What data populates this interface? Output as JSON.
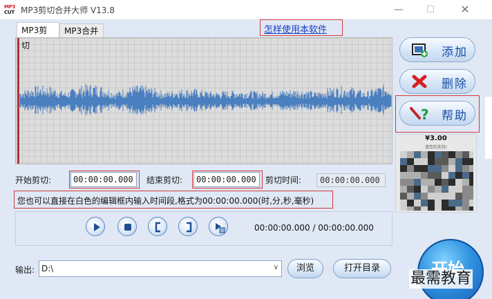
{
  "window": {
    "title": "MP3剪切合并大师 V13.8",
    "icon_top": "MP3",
    "icon_bottom": "CUT"
  },
  "tabs": [
    {
      "label": "MP3剪切",
      "active": true
    },
    {
      "label": "MP3合并",
      "active": false
    }
  ],
  "help_link": "怎样使用本软件",
  "side_buttons": {
    "add": "添加",
    "delete": "删除",
    "help": "帮助"
  },
  "donate": {
    "price": "¥3.00",
    "note": "请您的支持!"
  },
  "time_fields": {
    "start_label": "开始剪切:",
    "start_value": "00:00:00.000",
    "end_label": "结束剪切:",
    "end_value": "00:00:00.000",
    "duration_label": "剪切时间:",
    "duration_value": "00:00:00.000"
  },
  "hint": "您也可以直接在白色的编辑框内输入时间段,格式为00:00:00.000(时,分,秒,毫秒)",
  "player": {
    "time_display": "00:00:00.000 / 00:00:00.000"
  },
  "output": {
    "label": "输出:",
    "path": "D:\\",
    "browse": "浏览",
    "open_dir": "打开目录"
  },
  "start_button": "开始",
  "watermark": "最需教育",
  "colors": {
    "accent": "#1a4fa8",
    "wave": "#4a7fc0",
    "highlight": "#d43a3a",
    "background": "#dfe8f4"
  }
}
